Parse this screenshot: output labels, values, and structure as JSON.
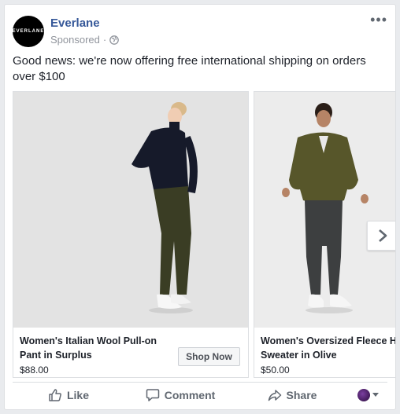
{
  "post": {
    "page_name": "Everlane",
    "avatar_text": "EVERLANE",
    "sponsored_label": "Sponsored",
    "separator": "·",
    "text": "Good news: we're now offering free international shipping on orders over $100"
  },
  "cards": [
    {
      "title": "Women's Italian Wool Pull-on Pant in Surplus",
      "price": "$88.00",
      "cta": "Shop Now",
      "image": "model-black-sweater-olive-pants"
    },
    {
      "title": "Women's Oversized Fleece Half-Zip Sweater in Olive",
      "title_visible": "Women's Oversized Fleece H Zip Sweater in Olive",
      "price": "$50.00",
      "image": "model-olive-fleece-grey-jeans"
    }
  ],
  "actions": {
    "like": "Like",
    "comment": "Comment",
    "share": "Share"
  },
  "icons": [
    "more-options-icon",
    "globe-icon",
    "chevron-right-icon",
    "like-icon",
    "comment-icon",
    "share-icon",
    "caret-down-icon"
  ],
  "colors": {
    "link": "#365899",
    "text": "#1d2129",
    "muted": "#90949c",
    "action": "#606770"
  }
}
